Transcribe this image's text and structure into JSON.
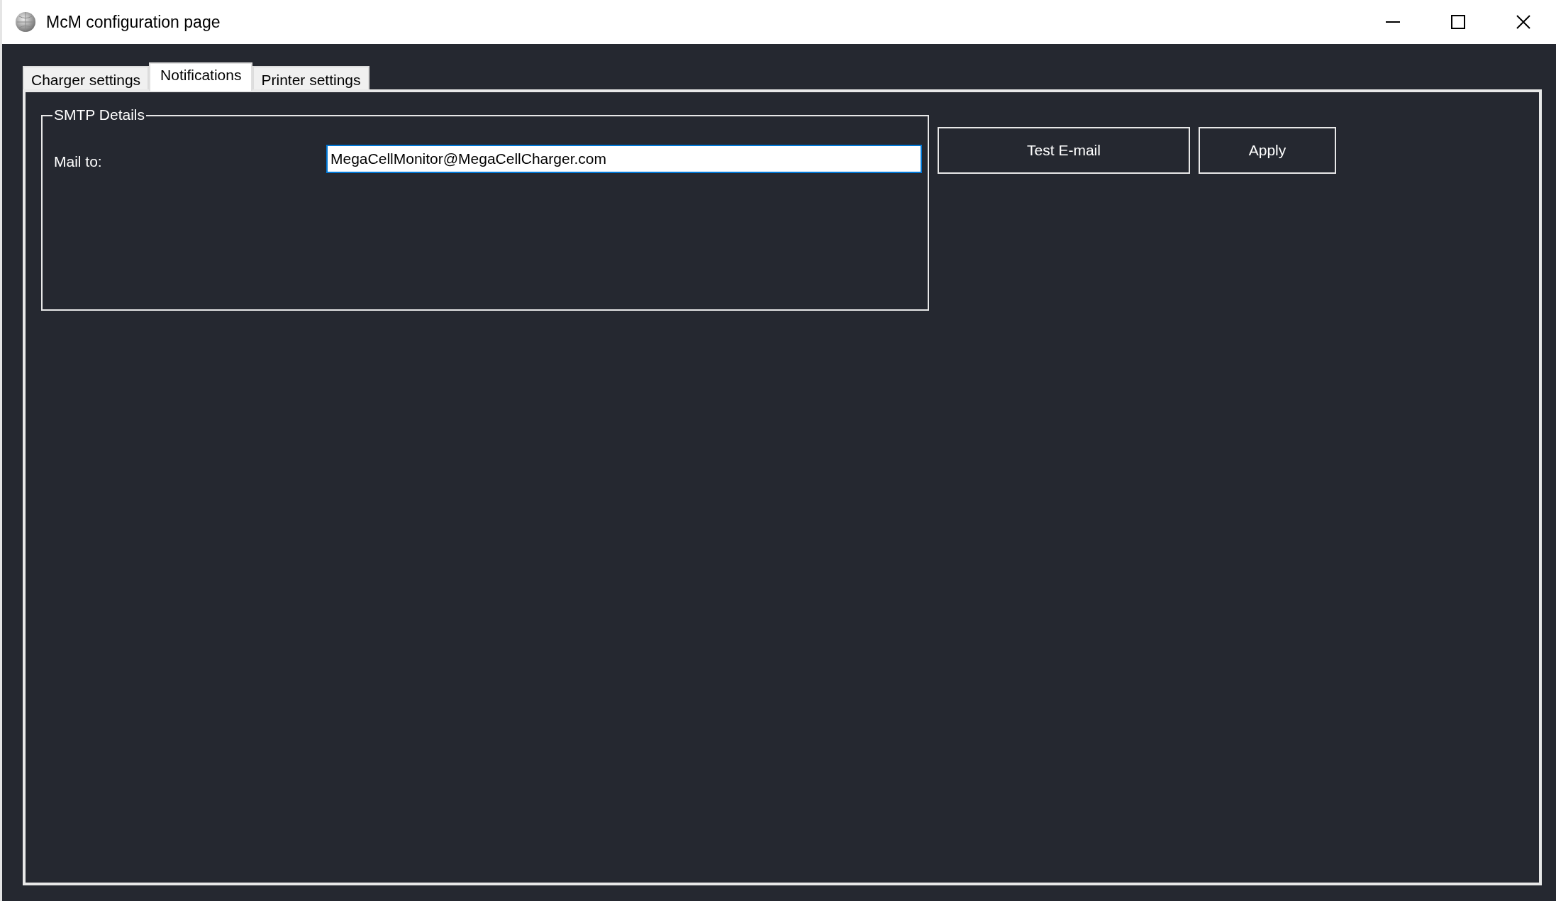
{
  "window": {
    "title": "McM configuration page"
  },
  "tabs": [
    {
      "label": "Charger settings",
      "selected": false
    },
    {
      "label": "Notifications",
      "selected": true
    },
    {
      "label": "Printer settings",
      "selected": false
    }
  ],
  "smtp_details": {
    "title": "SMTP Details",
    "mail_to": {
      "label": "Mail to:",
      "value": "MegaCellMonitor@MegaCellCharger.com",
      "focused": true
    }
  },
  "buttons": [
    {
      "label": "Test E-mail"
    },
    {
      "label": "Apply"
    }
  ]
}
